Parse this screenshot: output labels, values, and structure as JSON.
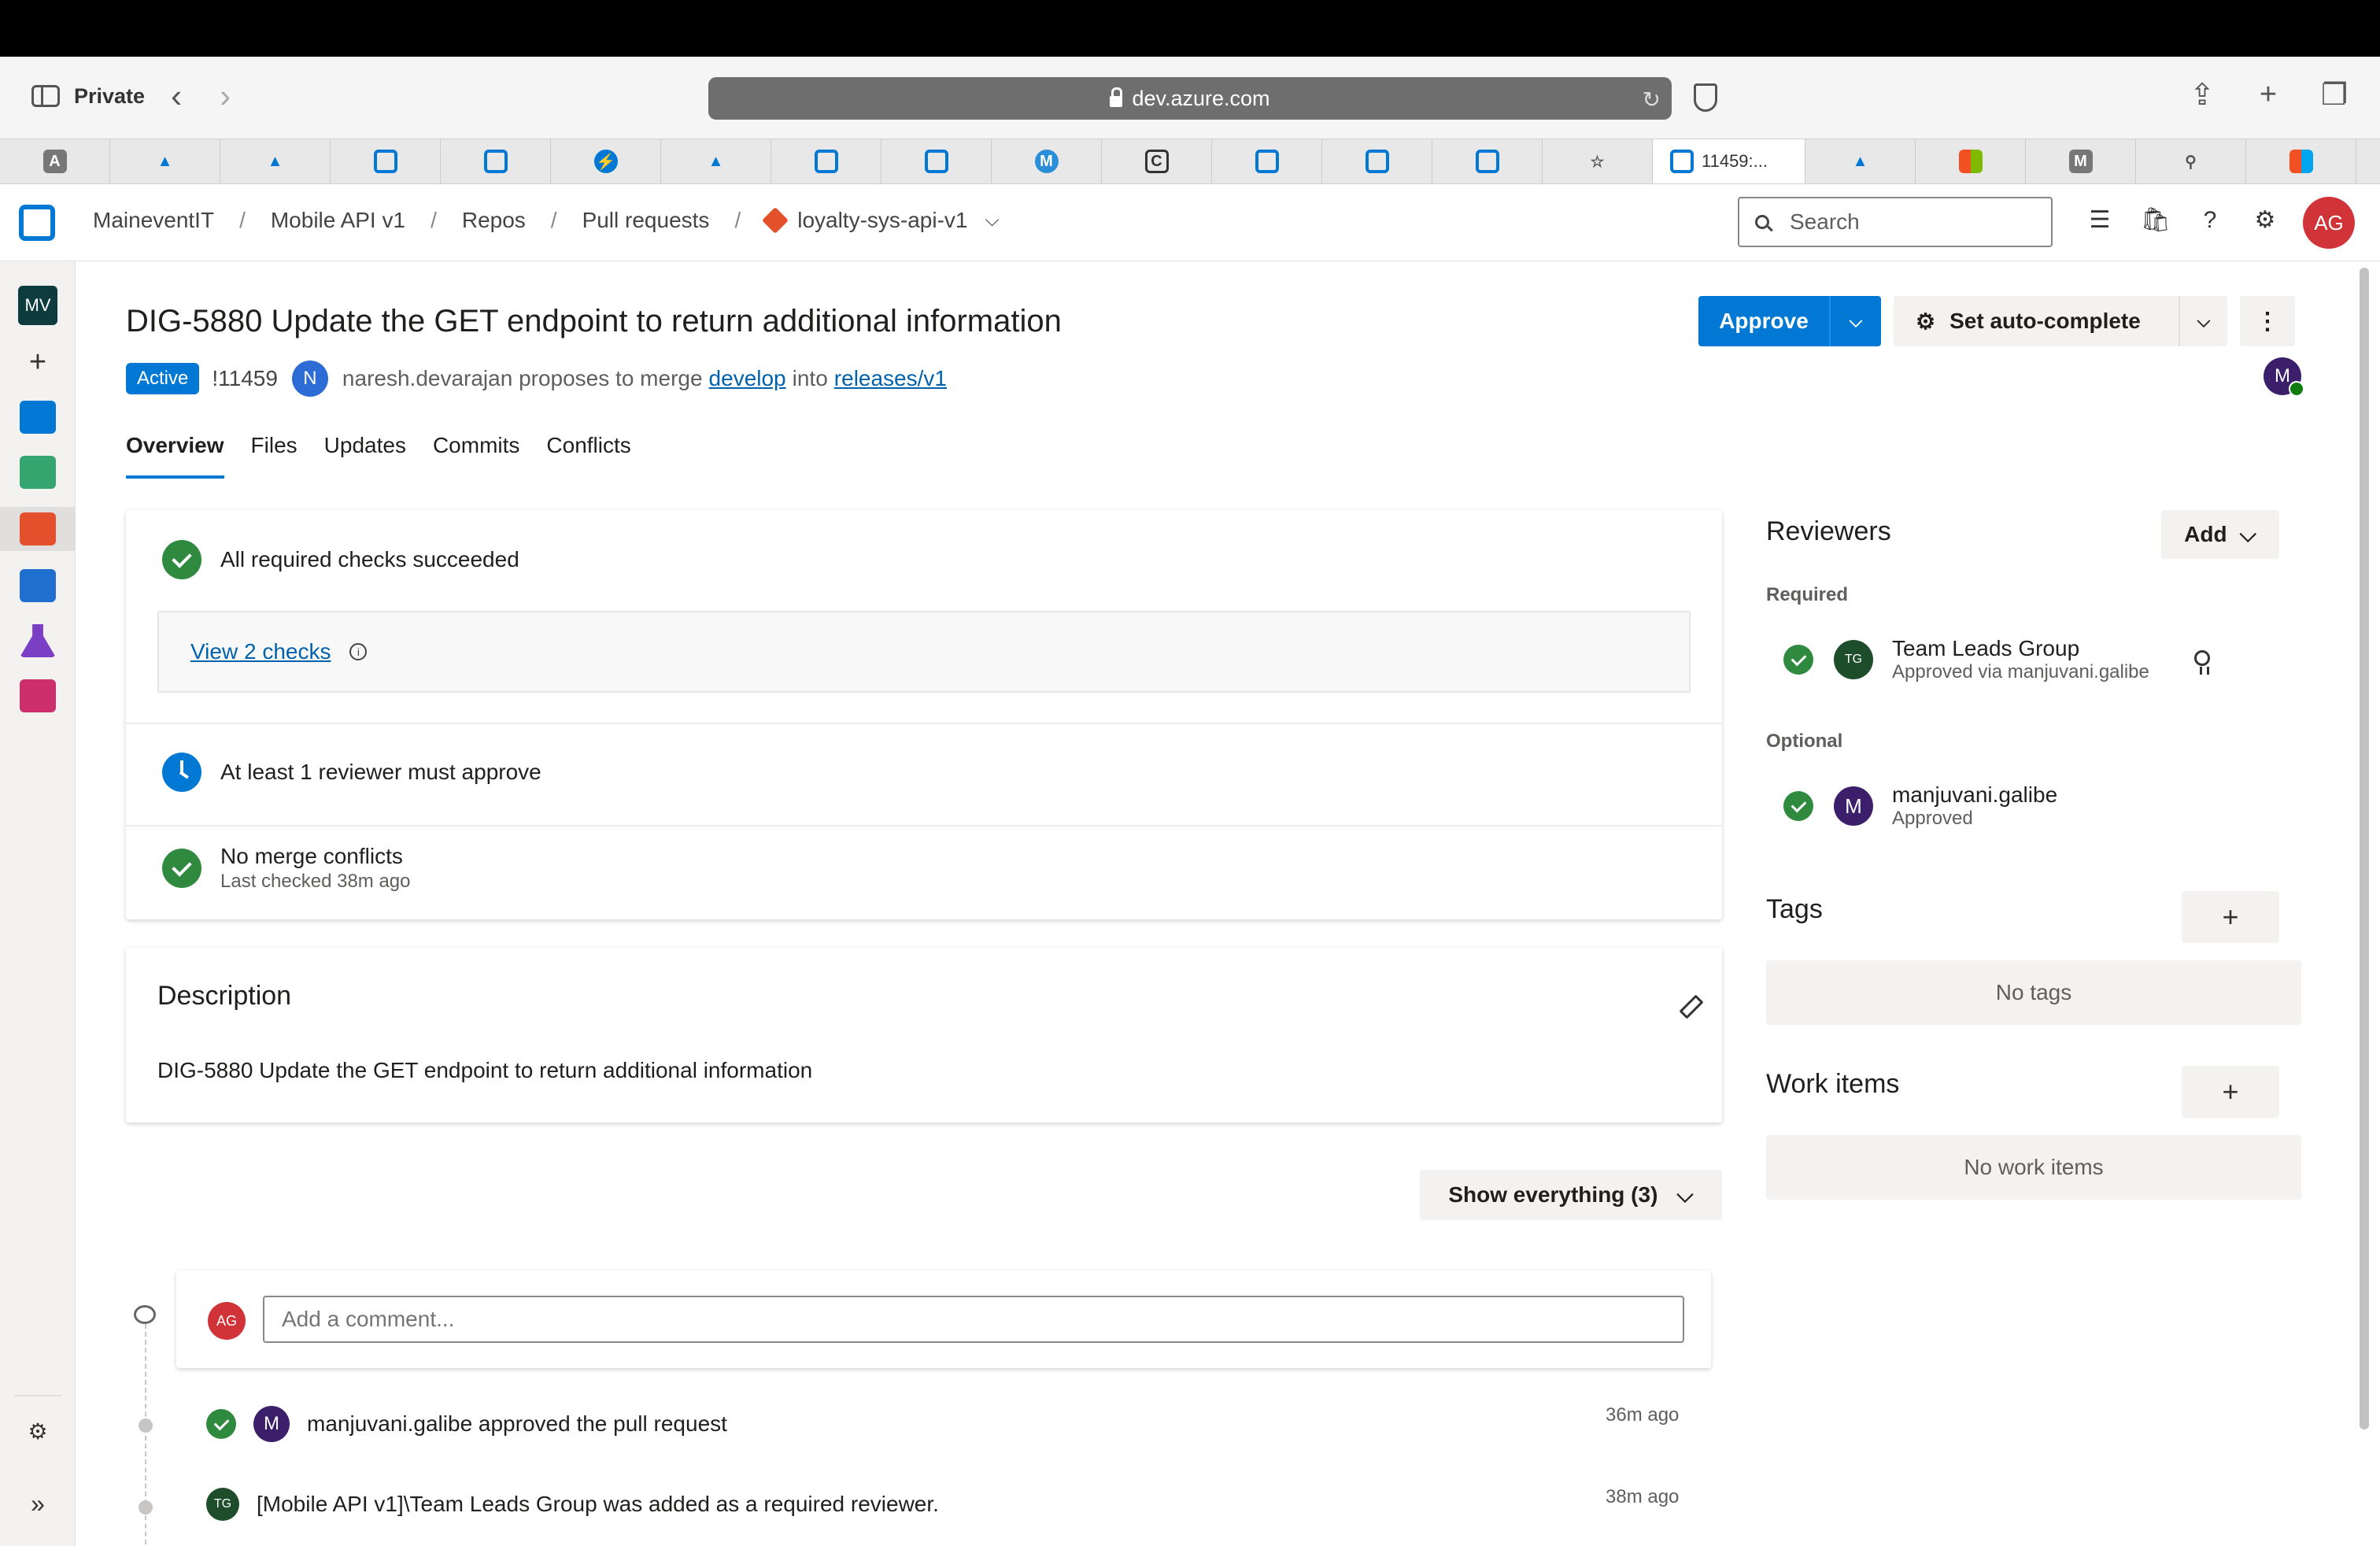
{
  "browser": {
    "private_label": "Private",
    "url": "dev.azure.com",
    "active_tab_title": "11459:..."
  },
  "header": {
    "breadcrumb": [
      "MaineventIT",
      "Mobile API v1",
      "Repos",
      "Pull requests"
    ],
    "repo_name": "loyalty-sys-api-v1",
    "search_placeholder": "Search",
    "user_initials": "AG",
    "project_initials": "MV"
  },
  "pr": {
    "title": "DIG-5880 Update the GET endpoint to return additional information",
    "status": "Active",
    "id": "!11459",
    "author_initial": "N",
    "author_text": "naresh.devarajan proposes to merge",
    "source_branch": "develop",
    "into_word": "into",
    "target_branch": "releases/v1",
    "reviewer_avatar_initial": "M"
  },
  "actions": {
    "approve_label": "Approve",
    "autocomplete_label": "Set auto-complete"
  },
  "tabs": [
    "Overview",
    "Files",
    "Updates",
    "Commits",
    "Conflicts"
  ],
  "checks": {
    "all_required": "All required checks succeeded",
    "view_checks": "View 2 checks",
    "reviewer_policy": "At least 1 reviewer must approve",
    "merge_conflicts": "No merge conflicts",
    "last_checked": "Last checked 38m ago"
  },
  "description": {
    "title": "Description",
    "text": "DIG-5880 Update the GET endpoint to return additional information"
  },
  "activity": {
    "show_filter": "Show everything (3)",
    "comment_placeholder": "Add a comment...",
    "commenter_initials": "AG",
    "events": [
      {
        "avatar": "M",
        "text": "manjuvani.galibe approved the pull request",
        "time": "36m ago"
      },
      {
        "avatar": "TG",
        "text": "[Mobile API v1]\\Team Leads Group was added as a required reviewer.",
        "time": "38m ago"
      }
    ]
  },
  "sidebar": {
    "reviewers_title": "Reviewers",
    "add_label": "Add",
    "required_label": "Required",
    "optional_label": "Optional",
    "required_reviewers": [
      {
        "initials": "TG",
        "name": "Team Leads Group",
        "status": "Approved via manjuvani.galibe"
      }
    ],
    "optional_reviewers": [
      {
        "initials": "M",
        "name": "manjuvani.galibe",
        "status": "Approved"
      }
    ],
    "tags_title": "Tags",
    "no_tags": "No tags",
    "work_items_title": "Work items",
    "no_work_items": "No work items"
  },
  "colors": {
    "accent": "#0078d4",
    "success": "#2f8a3f",
    "avatar_red": "#d13438",
    "avatar_purple": "#3b1f6b",
    "avatar_green": "#1e4d2b"
  }
}
